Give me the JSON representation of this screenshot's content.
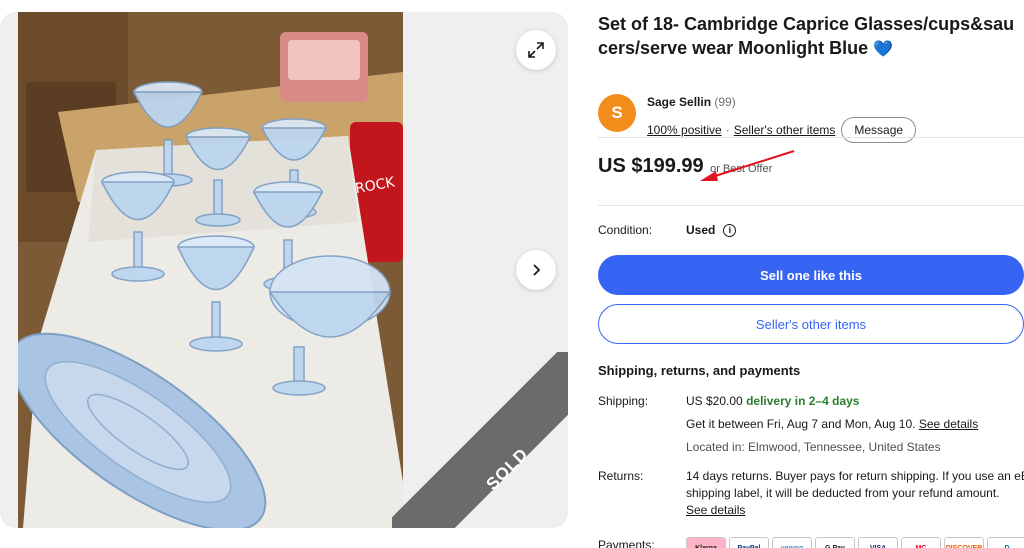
{
  "gallery": {
    "sold_label": "SOLD",
    "expand_icon": "expand-arrows-icon",
    "next_icon": "chevron-right-icon"
  },
  "listing": {
    "title": "Set of 18- Cambridge Caprice Glasses/cups&saucers/serve wear Moonlight Blue",
    "title_emoji": "💙"
  },
  "seller": {
    "avatar_letter": "S",
    "name": "Sage Sellin",
    "score": "(99)",
    "positive": "100% positive",
    "separator": "·",
    "other_items_link": "Seller's other items",
    "message_button": "Message"
  },
  "price": {
    "amount": "US $199.99",
    "offer_text": "or Best Offer"
  },
  "condition": {
    "label": "Condition:",
    "value": "Used",
    "info_icon": "i"
  },
  "actions": {
    "primary": "Sell one like this",
    "secondary": "Seller's other items"
  },
  "shipping": {
    "heading": "Shipping, returns, and payments",
    "shipping_label": "Shipping:",
    "cost": "US $20.00",
    "delivery": "delivery in 2–4 days",
    "window": "Get it between Fri, Aug 7 and Mon, Aug 10.",
    "see_details": "See details",
    "location": "Located in: Elmwood, Tennessee, United States",
    "returns_label": "Returns:",
    "returns_line1": "14 days returns. Buyer pays for return shipping. If you use an eB",
    "returns_line2": "shipping label, it will be deducted from your refund amount.",
    "returns_details": "See details",
    "payments_label": "Payments:"
  },
  "payments": [
    "Klarna",
    "PayPal",
    "venmo",
    "G Pay",
    "VISA",
    "MC",
    "DISCOVER",
    "D"
  ],
  "colors": {
    "primary_blue": "#3665f3",
    "avatar_orange": "#f28c1b",
    "delivery_green": "#2a7d2a",
    "annotation_red": "#e0141e"
  }
}
